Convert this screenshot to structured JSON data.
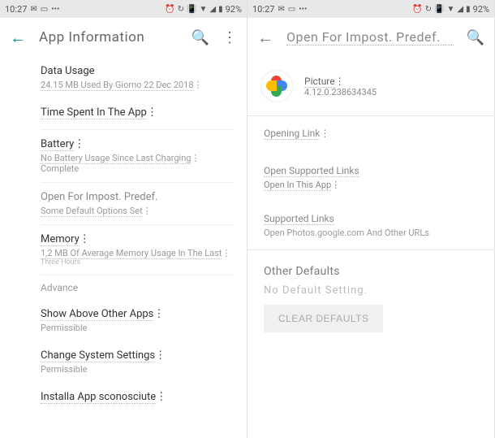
{
  "status": {
    "time": "10:27",
    "battery": "92%"
  },
  "left": {
    "title": "App Information",
    "data_usage": {
      "label": "Data Usage",
      "sub": "24.15 MB Used By Giorno 22 Dec 2018"
    },
    "time_spent": {
      "label": "Time Spent In The App"
    },
    "battery": {
      "label": "Battery",
      "sub": "No Battery Usage Since Last Charging",
      "sub2": "Complete"
    },
    "open_default": {
      "label": "Open For Impost. Predef.",
      "sub": "Some Default Options Set"
    },
    "memory": {
      "label": "Memory",
      "sub": "1,2 MB Of Average Memory Usage In The Last",
      "sub2": "Three Hours"
    },
    "advance": "Advance",
    "show_above": {
      "label": "Show Above Other Apps",
      "sub": "Permissible"
    },
    "change_system": {
      "label": "Change System Settings",
      "sub": "Permissible"
    },
    "installa": {
      "label": "Installa App sconosciute"
    }
  },
  "right": {
    "title": "Open For Impost. Predef.",
    "app": {
      "name": "Picture",
      "version": "4.12.0.238634345"
    },
    "opening_link": "Opening Link",
    "supported": {
      "label": "Open Supported Links",
      "value": "Open In This App"
    },
    "supported_links": {
      "label": "Supported Links",
      "value": "Open Photos.google.com And Other URLs"
    },
    "other_defaults": "Other Defaults",
    "no_defaults": "No Default Setting.",
    "clear": "CLEAR DEFAULTS"
  }
}
